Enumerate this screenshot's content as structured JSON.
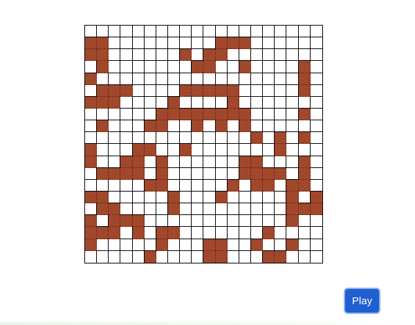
{
  "game": {
    "grid": {
      "rows": 20,
      "cols": 20,
      "cell_colors": {
        "alive": "#a0472c",
        "dead": "#ffffff",
        "line": "#000000"
      },
      "alive_cells": [
        [
          1,
          0
        ],
        [
          1,
          1
        ],
        [
          1,
          11
        ],
        [
          1,
          12
        ],
        [
          1,
          13
        ],
        [
          2,
          0
        ],
        [
          2,
          1
        ],
        [
          2,
          8
        ],
        [
          2,
          10
        ],
        [
          2,
          11
        ],
        [
          3,
          1
        ],
        [
          3,
          9
        ],
        [
          3,
          10
        ],
        [
          3,
          13
        ],
        [
          3,
          18
        ],
        [
          4,
          0
        ],
        [
          4,
          18
        ],
        [
          5,
          1
        ],
        [
          5,
          2
        ],
        [
          5,
          3
        ],
        [
          5,
          8
        ],
        [
          5,
          9
        ],
        [
          5,
          10
        ],
        [
          5,
          11
        ],
        [
          5,
          12
        ],
        [
          5,
          18
        ],
        [
          6,
          0
        ],
        [
          6,
          1
        ],
        [
          6,
          2
        ],
        [
          6,
          7
        ],
        [
          6,
          12
        ],
        [
          7,
          6
        ],
        [
          7,
          7
        ],
        [
          7,
          8
        ],
        [
          7,
          9
        ],
        [
          7,
          10
        ],
        [
          7,
          11
        ],
        [
          7,
          12
        ],
        [
          7,
          13
        ],
        [
          7,
          18
        ],
        [
          8,
          1
        ],
        [
          8,
          5
        ],
        [
          8,
          6
        ],
        [
          8,
          9
        ],
        [
          8,
          11
        ],
        [
          8,
          13
        ],
        [
          9,
          14
        ],
        [
          9,
          16
        ],
        [
          9,
          18
        ],
        [
          10,
          0
        ],
        [
          10,
          4
        ],
        [
          10,
          5
        ],
        [
          10,
          8
        ],
        [
          10,
          16
        ],
        [
          11,
          0
        ],
        [
          11,
          3
        ],
        [
          11,
          4
        ],
        [
          11,
          6
        ],
        [
          11,
          13
        ],
        [
          11,
          14
        ],
        [
          11,
          18
        ],
        [
          12,
          1
        ],
        [
          12,
          2
        ],
        [
          12,
          3
        ],
        [
          12,
          4
        ],
        [
          12,
          6
        ],
        [
          12,
          13
        ],
        [
          12,
          14
        ],
        [
          12,
          15
        ],
        [
          12,
          16
        ],
        [
          12,
          18
        ],
        [
          13,
          5
        ],
        [
          13,
          6
        ],
        [
          13,
          12
        ],
        [
          13,
          14
        ],
        [
          13,
          15
        ],
        [
          13,
          17
        ],
        [
          13,
          18
        ],
        [
          14,
          0
        ],
        [
          14,
          1
        ],
        [
          14,
          7
        ],
        [
          14,
          11
        ],
        [
          14,
          17
        ],
        [
          14,
          19
        ],
        [
          15,
          1
        ],
        [
          15,
          2
        ],
        [
          15,
          7
        ],
        [
          15,
          17
        ],
        [
          15,
          18
        ],
        [
          15,
          19
        ],
        [
          16,
          0
        ],
        [
          16,
          2
        ],
        [
          16,
          3
        ],
        [
          16,
          4
        ],
        [
          16,
          17
        ],
        [
          17,
          0
        ],
        [
          17,
          1
        ],
        [
          17,
          2
        ],
        [
          17,
          4
        ],
        [
          17,
          6
        ],
        [
          17,
          7
        ],
        [
          17,
          15
        ],
        [
          18,
          0
        ],
        [
          18,
          6
        ],
        [
          18,
          10
        ],
        [
          18,
          11
        ],
        [
          18,
          14
        ],
        [
          18,
          17
        ],
        [
          19,
          5
        ],
        [
          19,
          10
        ],
        [
          19,
          11
        ],
        [
          19,
          15
        ],
        [
          19,
          16
        ]
      ]
    }
  },
  "controls": {
    "play_label": "Play"
  }
}
